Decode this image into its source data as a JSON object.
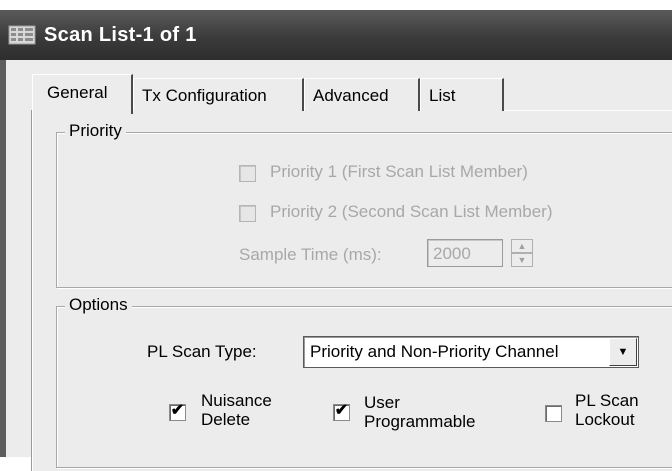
{
  "window": {
    "title": "Scan List-1 of 1",
    "icon": "scan-list-grid-icon"
  },
  "tabs": [
    {
      "label": "General",
      "active": true
    },
    {
      "label": "Tx Configuration",
      "active": false
    },
    {
      "label": "Advanced",
      "active": false
    },
    {
      "label": "List",
      "active": false
    }
  ],
  "priority": {
    "legend": "Priority",
    "priority1": {
      "label": "Priority 1 (First Scan List Member)",
      "checked": false,
      "enabled": false
    },
    "priority2": {
      "label": "Priority 2 (Second Scan List Member)",
      "checked": false,
      "enabled": false
    },
    "sample_time": {
      "label": "Sample Time (ms):",
      "value": "2000",
      "enabled": false
    }
  },
  "options": {
    "legend": "Options",
    "pl_scan_type": {
      "label": "PL Scan Type:",
      "value": "Priority and Non-Priority Channel"
    },
    "nuisance_delete": {
      "line1": "Nuisance",
      "line2": "Delete",
      "checked": true
    },
    "user_programmable": {
      "line1": "User",
      "line2": "Programmable",
      "checked": true
    },
    "pl_scan_lockout": {
      "line1": "PL Scan",
      "line2": "Lockout",
      "checked": false
    }
  },
  "glyphs": {
    "check": "✔",
    "arrow_up": "▲",
    "arrow_down": "▼"
  },
  "colors": {
    "titlebar": "#3b3b3b",
    "dialog_bg": "#ececec",
    "disabled_text": "#a8a8a8"
  }
}
